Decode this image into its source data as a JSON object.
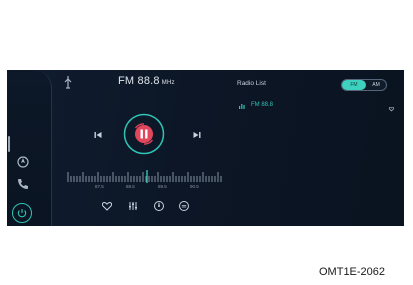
{
  "header": {
    "station": "FM 88.8",
    "unit": "MHz"
  },
  "tuner": {
    "labels": [
      "87.5",
      "88.5",
      "89.5",
      "90.5"
    ]
  },
  "radio_list": {
    "title": "Radio List",
    "bands": {
      "fm": "FM",
      "am": "AM",
      "selected": "FM"
    },
    "items": [
      {
        "label": "FM 88.8",
        "playing": true
      }
    ]
  },
  "caption": "OMT1E-2062",
  "colors": {
    "accent": "#2fc4b6",
    "play_icon": "#e2465c",
    "background": "#0c1626"
  },
  "icons": {
    "sidebar": [
      "navigation-icon",
      "phone-icon",
      "home-icon"
    ],
    "top": "antenna-icon",
    "bottom": [
      "favorite-icon",
      "equalizer-icon",
      "scan-icon",
      "search-icon"
    ]
  }
}
